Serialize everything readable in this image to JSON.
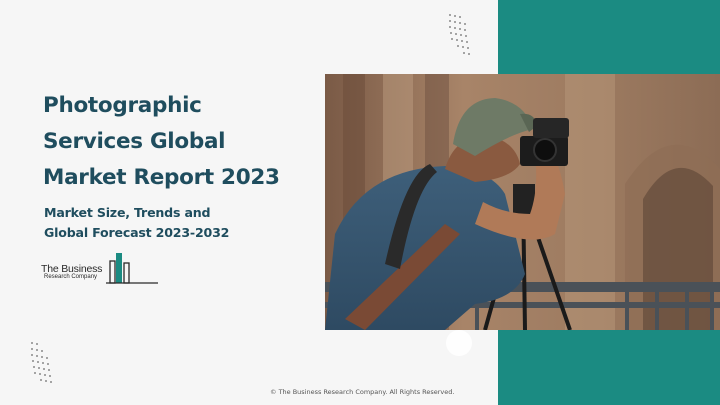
{
  "title_lines": [
    "Photographic",
    "Services Global",
    "Market Report 2023"
  ],
  "subtitle_lines": [
    "Market Size, Trends and",
    "Global Forecast 2023-2032"
  ],
  "logo": {
    "name": "The Business",
    "sub": "Research Company"
  },
  "footer": "© The Business Research Company. All Rights Reserved.",
  "colors": {
    "accent": "#1b8b82",
    "title": "#1f4d5e",
    "background": "#f6f6f6"
  },
  "photo": {
    "subject": "photographer-with-camera-on-tripod"
  }
}
